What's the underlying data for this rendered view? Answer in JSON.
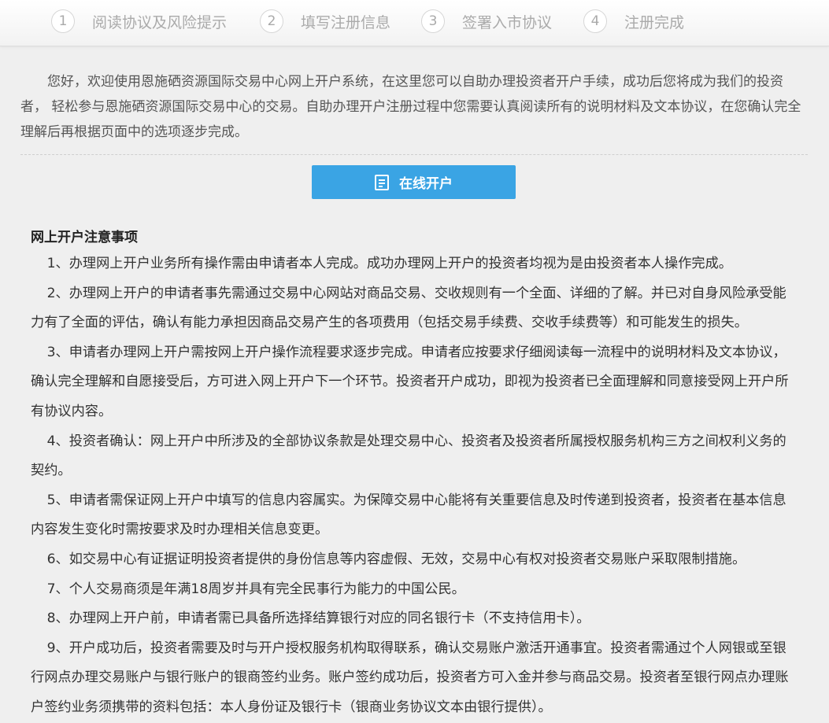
{
  "steps": [
    {
      "num": "1",
      "label": "阅读协议及风险提示"
    },
    {
      "num": "2",
      "label": "填写注册信息"
    },
    {
      "num": "3",
      "label": "签署入市协议"
    },
    {
      "num": "4",
      "label": "注册完成"
    }
  ],
  "intro": "您好，欢迎使用恩施硒资源国际交易中心网上开户系统，在这里您可以自助办理投资者开户手续，成功后您将成为我们的投资者， 轻松参与恩施硒资源国际交易中心的交易。自助办理开户注册过程中您需要认真阅读所有的说明材料及文本协议，在您确认完全理解后再根据页面中的选项逐步完成。",
  "open_button": {
    "label": "在线开户",
    "icon": "document-icon"
  },
  "notice": {
    "title": "网上开户注意事项",
    "items": [
      "1、办理网上开户业务所有操作需由申请者本人完成。成功办理网上开户的投资者均视为是由投资者本人操作完成。",
      "2、办理网上开户的申请者事先需通过交易中心网站对商品交易、交收规则有一个全面、详细的了解。并已对自身风险承受能力有了全面的评估，确认有能力承担因商品交易产生的各项费用（包括交易手续费、交收手续费等）和可能发生的损失。",
      "3、申请者办理网上开户需按网上开户操作流程要求逐步完成。申请者应按要求仔细阅读每一流程中的说明材料及文本协议，确认完全理解和自愿接受后，方可进入网上开户下一个环节。投资者开户成功，即视为投资者已全面理解和同意接受网上开户所有协议内容。",
      "4、投资者确认：网上开户中所涉及的全部协议条款是处理交易中心、投资者及投资者所属授权服务机构三方之间权利义务的契约。",
      "5、申请者需保证网上开户中填写的信息内容属实。为保障交易中心能将有关重要信息及时传递到投资者，投资者在基本信息内容发生变化时需按要求及时办理相关信息变更。",
      "6、如交易中心有证据证明投资者提供的身份信息等内容虚假、无效，交易中心有权对投资者交易账户采取限制措施。",
      "7、个人交易商须是年满18周岁并具有完全民事行为能力的中国公民。",
      "8、办理网上开户前，申请者需已具备所选择结算银行对应的同名银行卡（不支持信用卡）。",
      "9、开户成功后，投资者需要及时与开户授权服务机构取得联系，确认交易账户激活开通事宜。投资者需通过个人网银或至银行网点办理交易账户与银行账户的银商签约业务。账户签约成功后，投资者方可入金并参与商品交易。投资者至银行网点办理账户签约业务须携带的资料包括：本人身份证及银行卡（银商业务协议文本由银行提供）。"
    ]
  },
  "colors": {
    "accent": "#3aa4e4",
    "step_text": "#aaaaaa",
    "background": "#efefef"
  }
}
